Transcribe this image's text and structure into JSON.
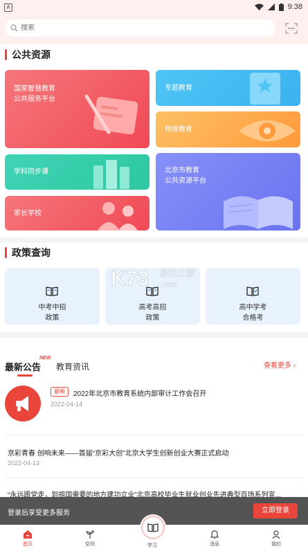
{
  "status_bar": {
    "time": "9:38",
    "app_badge": "A"
  },
  "search": {
    "placeholder": "搜索",
    "icon": "search-icon",
    "scan_icon": "scan-icon"
  },
  "sections": {
    "public_resources": "公共资源",
    "policy_query": "政策查询"
  },
  "resource_cards": {
    "national": {
      "line1": "国家智慧教育",
      "line2": "公共服务平台"
    },
    "special_topic": "专题教育",
    "special_ed": "特殊教育",
    "subject_sync": "学科同步课",
    "beijing": {
      "line1": "北京市教育",
      "line2": "公共资源平台"
    },
    "parent_school": "家长学校"
  },
  "policy_cards": [
    {
      "line1": "中考中招",
      "line2": "政策"
    },
    {
      "line1": "高考高招",
      "line2": "政策"
    },
    {
      "line1": "高中学考",
      "line2": "合格考"
    }
  ],
  "tabs": {
    "active": "最新公告",
    "new_badge": "NEW",
    "other": "教育资讯",
    "more": "查看更多"
  },
  "news": [
    {
      "badge": "最新",
      "title": "2022年北京市教育系统内部审计工作会召开",
      "date": "2022-04-14"
    },
    {
      "title": "京彩青春 创响未来——首届“京彩大创”北京大学生创新创业大赛正式启动",
      "date": "2022-04-13"
    },
    {
      "title": "“永远跟党走，到祖国需要的地方建功立业”北京高校毕业生就业创业先进典型百场系列宣..."
    }
  ],
  "login_banner": {
    "message": "登录后享受更多服务",
    "button": "立即登录"
  },
  "bottom_nav": [
    {
      "label": "首页",
      "icon": "home-icon",
      "active": true
    },
    {
      "label": "空间",
      "icon": "sprout-icon"
    },
    {
      "label": "学习",
      "icon": "book-icon"
    },
    {
      "label": "消息",
      "icon": "bell-icon"
    },
    {
      "label": "我的",
      "icon": "profile-icon"
    }
  ],
  "watermark": {
    "brand": "K73",
    "text": "游戏之家",
    "url": ".com"
  },
  "colors": {
    "accent": "#e9453b",
    "header_bg": "#fdf0ef",
    "policy_bg": "#e8f2fc"
  }
}
